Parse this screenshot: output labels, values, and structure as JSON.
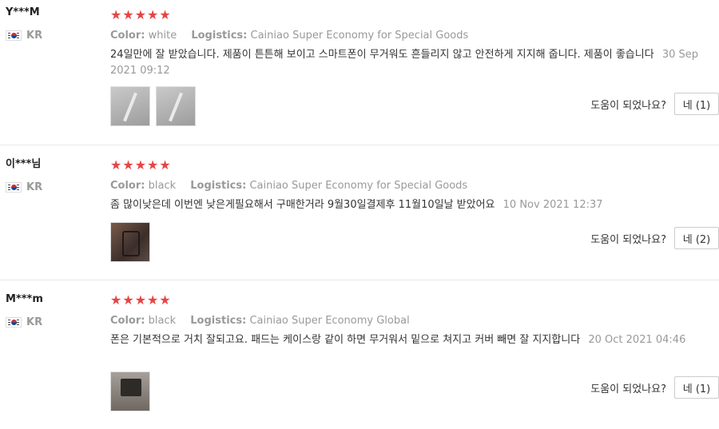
{
  "reviews": [
    {
      "user": "Y***M",
      "country": "KR",
      "stars": "★★★★★",
      "color_label": "Color:",
      "color_value": "white",
      "logistics_label": "Logistics:",
      "logistics_value": "Cainiao Super Economy for Special Goods",
      "text": "24일만에 잘 받았습니다. 제품이 튼튼해 보이고 스마트폰이 무거워도 흔들리지 않고 안전하게 지지해 줍니다. 제품이 좋습니다",
      "date": "30 Sep 2021 09:12",
      "helpful_question": "도움이 되었나요?",
      "helpful_button": "네 (1)",
      "rating": 5
    },
    {
      "user": "이***님",
      "country": "KR",
      "stars": "★★★★★",
      "color_label": "Color:",
      "color_value": "black",
      "logistics_label": "Logistics:",
      "logistics_value": "Cainiao Super Economy for Special Goods",
      "text": "좀 많이낮은데 이번엔 낮은게필요해서 구매한거라 9월30일결제후 11월10일날 받았어요",
      "date": "10 Nov 2021 12:37",
      "helpful_question": "도움이 되었나요?",
      "helpful_button": "네 (2)",
      "rating": 5
    },
    {
      "user": "M***m",
      "country": "KR",
      "stars": "★★★★★",
      "color_label": "Color:",
      "color_value": "black",
      "logistics_label": "Logistics:",
      "logistics_value": "Cainiao Super Economy Global",
      "text": "폰은 기본적으로 거치 잘되고요. 패드는 케이스랑 같이 하면 무거워서 밑으로 쳐지고 커버 빼면 잘 지지합니다",
      "date": "20 Oct 2021 04:46",
      "helpful_question": "도움이 되었나요?",
      "helpful_button": "네 (1)",
      "rating": 5
    }
  ],
  "colors": {
    "star": "#e64545",
    "muted": "#999999",
    "text": "#333333",
    "divider": "#e8e8e8"
  }
}
